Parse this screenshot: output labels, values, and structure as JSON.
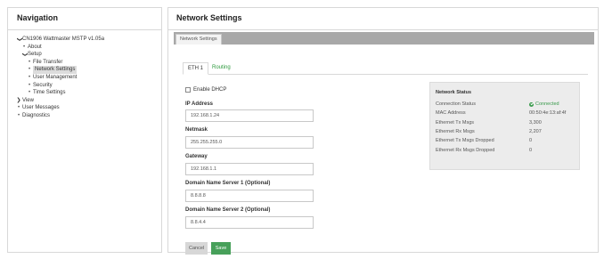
{
  "navigation": {
    "title": "Navigation",
    "tree": [
      {
        "label": "CN1906 Wattmaster MSTP v1.05a",
        "marker": "caret-down",
        "level": 1
      },
      {
        "label": "About",
        "marker": "bullet",
        "level": 2
      },
      {
        "label": "Setup",
        "marker": "caret-down",
        "level": 2
      },
      {
        "label": "File Transfer",
        "marker": "bullet",
        "level": 3
      },
      {
        "label": "Network Settings",
        "marker": "bullet",
        "level": 3,
        "selected": true
      },
      {
        "label": "User Management",
        "marker": "bullet",
        "level": 3
      },
      {
        "label": "Security",
        "marker": "bullet",
        "level": 3
      },
      {
        "label": "Time Settings",
        "marker": "bullet",
        "level": 3
      },
      {
        "label": "View",
        "marker": "caret-right",
        "level": 1
      },
      {
        "label": "User Messages",
        "marker": "bullet",
        "level": 1
      },
      {
        "label": "Diagnostics",
        "marker": "bullet",
        "level": 1
      }
    ]
  },
  "main": {
    "title": "Network Settings",
    "tab_label": "Network Settings",
    "subtabs": {
      "eth1": "ETH 1",
      "routing": "Routing"
    },
    "form": {
      "enable_dhcp_label": "Enable DHCP",
      "enable_dhcp_checked": false,
      "ip_label": "IP Address",
      "ip_value": "192.168.1.24",
      "netmask_label": "Netmask",
      "netmask_value": "255.255.255.0",
      "gateway_label": "Gateway",
      "gateway_value": "192.168.1.1",
      "dns1_label": "Domain Name Server 1 (Optional)",
      "dns1_value": "8.8.8.8",
      "dns2_label": "Domain Name Server 2 (Optional)",
      "dns2_value": "8.8.4.4"
    },
    "buttons": {
      "cancel": "Cancel",
      "save": "Save"
    },
    "status": {
      "title": "Network Status",
      "rows": [
        {
          "key": "Connection Status",
          "value": "Connected"
        },
        {
          "key": "MAC Address",
          "value": "00:50:4e:13:af:4f"
        },
        {
          "key": "Ethernet Tx Msgs",
          "value": "3,300"
        },
        {
          "key": "Ethernet Rx Msgs",
          "value": "2,207"
        },
        {
          "key": "Ethernet Tx Msgs Dropped",
          "value": "0"
        },
        {
          "key": "Ethernet Rx Msgs Dropped",
          "value": "0"
        }
      ]
    }
  },
  "colors": {
    "accent_green": "#47a05a",
    "link_green": "#2e9a3e",
    "status_panel_bg": "#ececec",
    "tabstrip_gray": "#a8a8a8"
  }
}
